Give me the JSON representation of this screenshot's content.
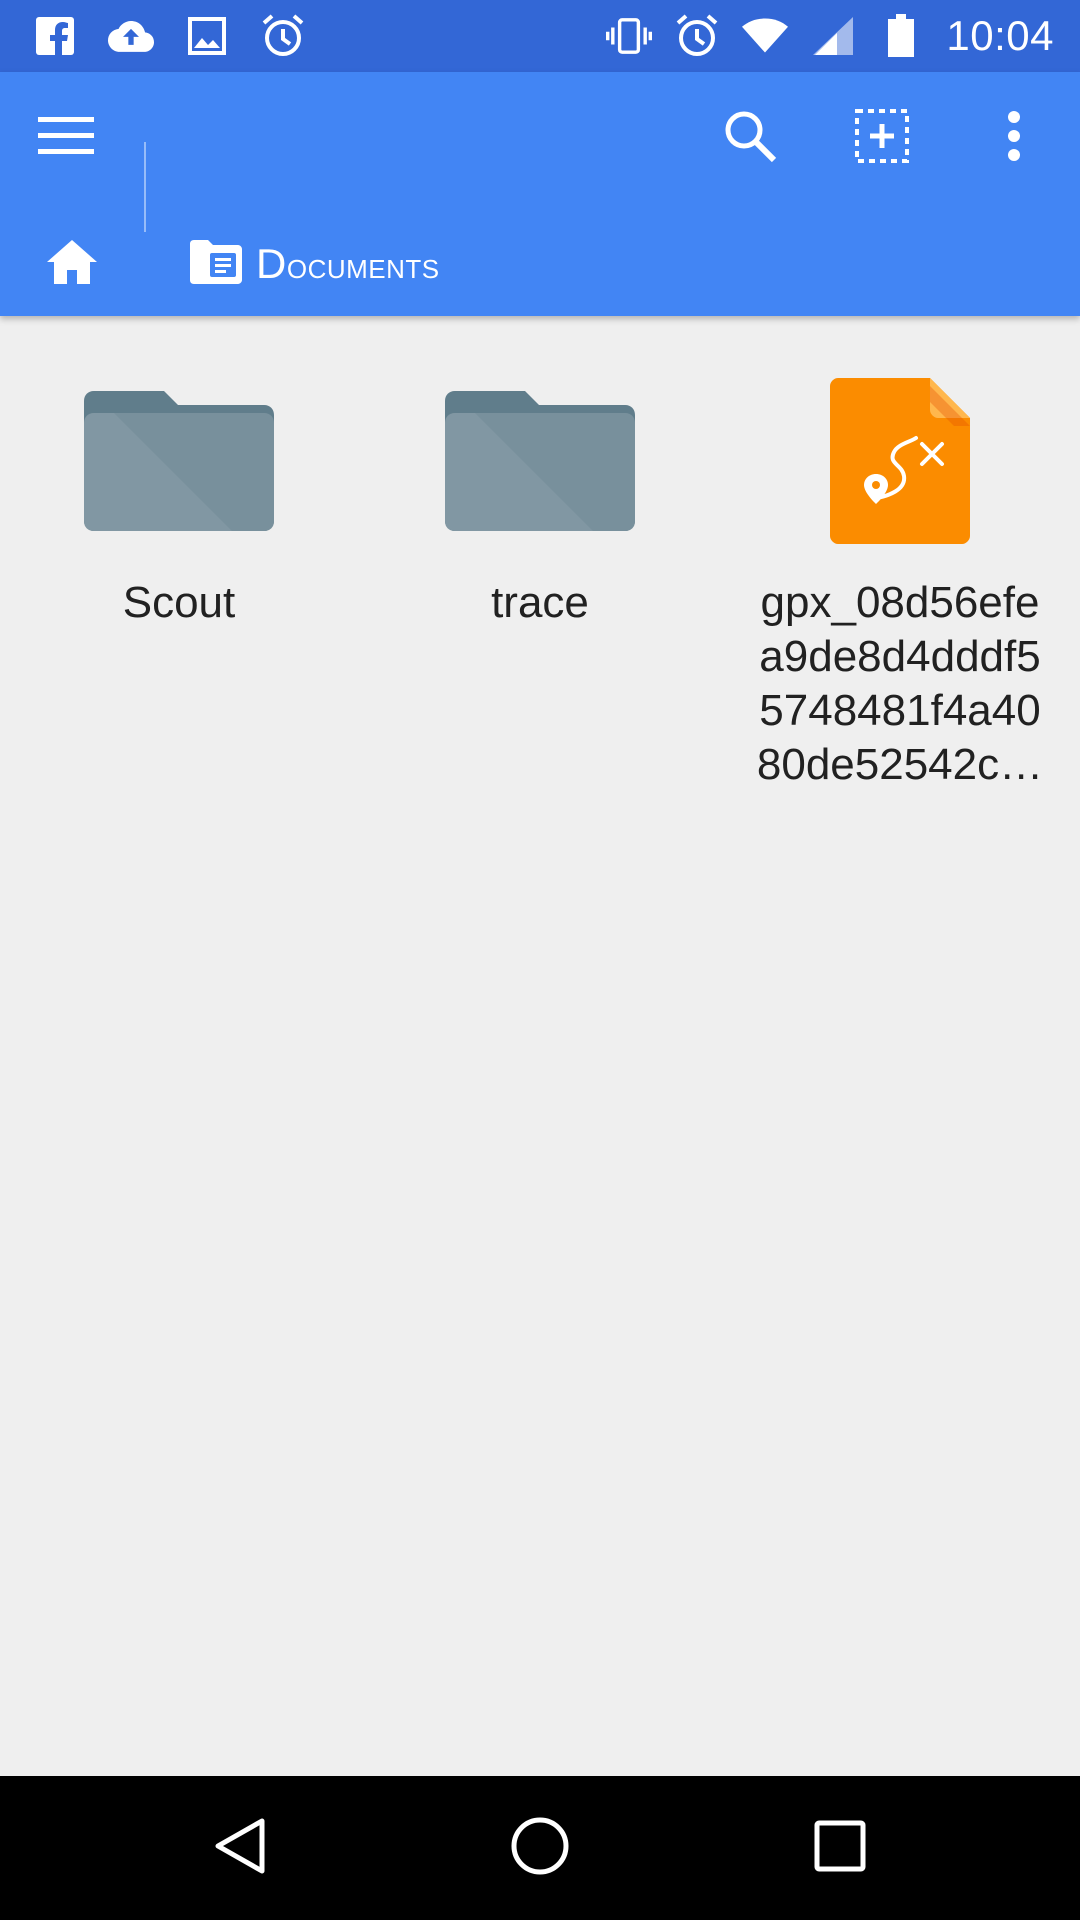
{
  "status_bar": {
    "time": "10:04",
    "left_icons": [
      "facebook-icon",
      "cloud-upload-icon",
      "image-icon",
      "alarm-icon"
    ],
    "right_icons": [
      "vibrate-icon",
      "alarm-icon",
      "wifi-icon",
      "signal-icon",
      "battery-icon"
    ]
  },
  "toolbar": {
    "menu_icon": "menu-icon",
    "search_icon": "search-icon",
    "select_icon": "select-add-icon",
    "more_icon": "more-vert-icon"
  },
  "breadcrumb": {
    "home_icon": "home-icon",
    "current_icon": "documents-folder-icon",
    "current_label": "Documents"
  },
  "items": [
    {
      "type": "folder",
      "name": "Scout"
    },
    {
      "type": "folder",
      "name": "trace"
    },
    {
      "type": "gpx-file",
      "name": "gpx_08d56efea9de8d4dddf55748481f4a4080de52542c…"
    }
  ],
  "colors": {
    "status_bar": "#3367d6",
    "app_bar": "#4285f4",
    "background": "#efefef",
    "folder": "#78909c",
    "gpx_file": "#fb8c00"
  },
  "nav_bar": {
    "back_icon": "back-icon",
    "home_icon": "home-circle-icon",
    "recents_icon": "recents-icon"
  }
}
